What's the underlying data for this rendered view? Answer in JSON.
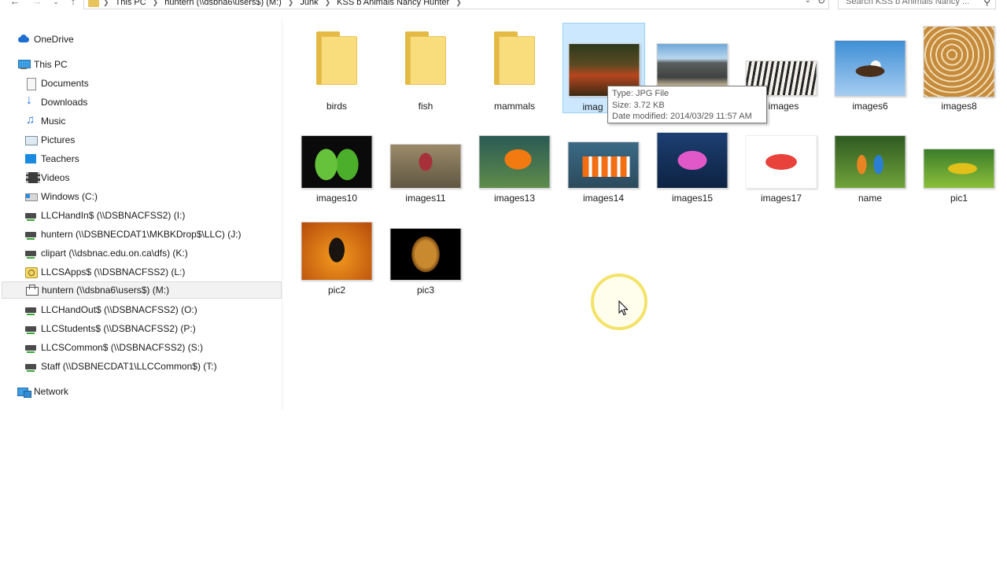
{
  "address_bar": {
    "crumbs": [
      "This PC",
      "huntern (\\\\dsbna6\\users$) (M:)",
      "Junk",
      "KSS b Animals Nancy Hunter"
    ],
    "search_placeholder": "Search KSS b Animals Nancy ..."
  },
  "nav_pane": {
    "onedrive": "OneDrive",
    "this_pc": "This PC",
    "items": [
      {
        "label": "Documents",
        "icon": "documents-icon"
      },
      {
        "label": "Downloads",
        "icon": "downloads-icon"
      },
      {
        "label": "Music",
        "icon": "music-icon"
      },
      {
        "label": "Pictures",
        "icon": "pictures-icon"
      },
      {
        "label": "Teachers",
        "icon": "folder-blue-icon"
      },
      {
        "label": "Videos",
        "icon": "videos-icon"
      },
      {
        "label": "Windows (C:)",
        "icon": "windows-drive-icon"
      },
      {
        "label": "LLCHandIn$ (\\\\DSBNACFSS2) (I:)",
        "icon": "network-drive-icon"
      },
      {
        "label": "huntern (\\\\DSBNECDAT1\\MKBKDrop$\\LLC) (J:)",
        "icon": "network-drive-icon"
      },
      {
        "label": "clipart (\\\\dsbnac.edu.on.ca\\dfs) (K:)",
        "icon": "network-drive-icon"
      },
      {
        "label": "LLCSApps$ (\\\\DSBNACFSS2) (L:)",
        "icon": "app-drive-icon"
      },
      {
        "label": "huntern (\\\\dsbna6\\users$) (M:)",
        "icon": "mapped-drive-icon"
      },
      {
        "label": "LLCHandOut$ (\\\\DSBNACFSS2) (O:)",
        "icon": "network-drive-icon"
      },
      {
        "label": "LLCStudents$ (\\\\DSBNACFSS2) (P:)",
        "icon": "network-drive-icon"
      },
      {
        "label": "LLCSCommon$ (\\\\DSBNACFSS2) (S:)",
        "icon": "network-drive-icon"
      },
      {
        "label": "Staff (\\\\DSBNECDAT1\\LLCCommon$) (T:)",
        "icon": "network-drive-icon"
      }
    ],
    "network": "Network"
  },
  "files": [
    {
      "name": "birds",
      "kind": "folder"
    },
    {
      "name": "fish",
      "kind": "folder"
    },
    {
      "name": "mammals",
      "kind": "folder"
    },
    {
      "name": "imag",
      "kind": "image",
      "subject": "red-panda"
    },
    {
      "name": "",
      "kind": "image",
      "subject": "elephants"
    },
    {
      "name": "images",
      "kind": "image",
      "subject": "zebras"
    },
    {
      "name": "images6",
      "kind": "image",
      "subject": "eagle"
    },
    {
      "name": "images8",
      "kind": "image",
      "subject": "giraffes"
    },
    {
      "name": "images10",
      "kind": "image",
      "subject": "parakeets"
    },
    {
      "name": "images11",
      "kind": "image",
      "subject": "finch"
    },
    {
      "name": "images13",
      "kind": "image",
      "subject": "orange-fish"
    },
    {
      "name": "images14",
      "kind": "image",
      "subject": "clownfish"
    },
    {
      "name": "images15",
      "kind": "image",
      "subject": "pink-fish"
    },
    {
      "name": "images17",
      "kind": "image",
      "subject": "red-fish"
    },
    {
      "name": "name",
      "kind": "image",
      "subject": "lorikeets"
    },
    {
      "name": "pic1",
      "kind": "image",
      "subject": "macaw"
    },
    {
      "name": "pic2",
      "kind": "image",
      "subject": "baby-gorilla"
    },
    {
      "name": "pic3",
      "kind": "image",
      "subject": "lion"
    }
  ],
  "tooltip": {
    "type": "Type: JPG File",
    "size": "Size: 3.72 KB",
    "modified": "Date modified: 2014/03/29 11:57 AM"
  },
  "colors": {
    "selection_bg": "#cce8ff",
    "selection_border": "#99d1ff",
    "folder_yellow": "#f9dc7c",
    "cursor_halo": "#f3e36a"
  }
}
